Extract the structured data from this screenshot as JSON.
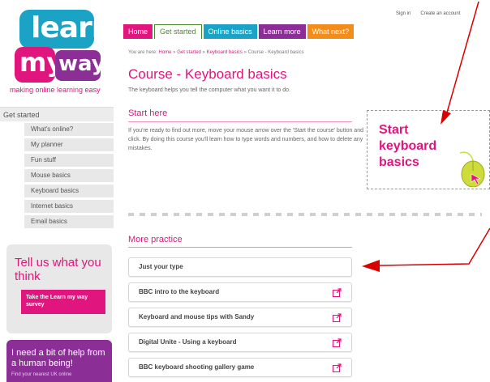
{
  "logo": {
    "learn": "learn",
    "my": "my",
    "way": "way",
    "tagline": "making online learning easy"
  },
  "toplinks": {
    "sign_in": "Sign in",
    "create_account": "Create an account"
  },
  "tabs": [
    {
      "label": "Home",
      "color": "#e0157e"
    },
    {
      "label": "Get started",
      "color": "#4a8a2a",
      "active": true
    },
    {
      "label": "Online basics",
      "color": "#1ba3c6"
    },
    {
      "label": "Learn more",
      "color": "#8b2f97"
    },
    {
      "label": "What next?",
      "color": "#f28c1a"
    }
  ],
  "breadcrumb": {
    "prefix": "You are here:",
    "home": "Home",
    "sep": "»",
    "get_started": "Get started",
    "keyboard_basics": "Keyboard basics",
    "current": "Course - Keyboard basics"
  },
  "page": {
    "title": "Course - Keyboard basics",
    "intro": "The keyboard helps you tell the computer what you want it to do.",
    "start_here_heading": "Start here",
    "start_here_text": "If you're ready to find out more, move your mouse arrow over the 'Start the course' button and click. By doing this course you'll learn how to type words and numbers, and how to delete any mistakes.",
    "start_button": "Start keyboard basics",
    "more_practice_heading": "More practice"
  },
  "sidebar": {
    "heading": "Get started",
    "items": [
      "What's online?",
      "My planner",
      "Fun stuff",
      "Mouse basics",
      "Keyboard basics",
      "Internet basics",
      "Email basics"
    ]
  },
  "tell_us": {
    "title": "Tell us what you think",
    "button": "Take the Learn my way survey"
  },
  "help": {
    "title": "I need a bit of help from a human being!",
    "sub": "Find your nearest UK online"
  },
  "practice": [
    {
      "label": "Just your type",
      "external": false
    },
    {
      "label": "BBC intro to the keyboard",
      "external": true
    },
    {
      "label": "Keyboard and mouse tips with Sandy",
      "external": true
    },
    {
      "label": "Digital Unite - Using a keyboard",
      "external": true
    },
    {
      "label": "BBC keyboard shooting gallery game",
      "external": true
    }
  ],
  "colors": {
    "pink": "#e0157e",
    "teal": "#1ba3c6",
    "purple": "#8b2f97",
    "green": "#4a8a2a",
    "orange": "#f28c1a",
    "annotation_red": "#d90000"
  }
}
